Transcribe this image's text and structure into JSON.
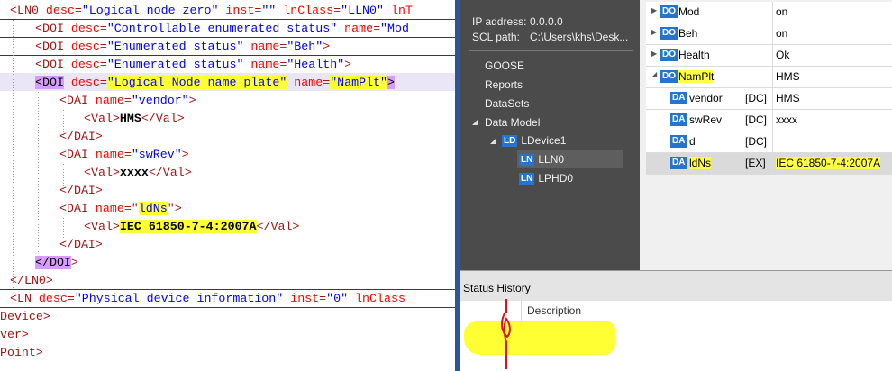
{
  "xml_editor": {
    "lines": [
      [
        {
          "c": "tg",
          "t": "<LN0 "
        },
        {
          "c": "at",
          "t": "desc"
        },
        {
          "c": "tg",
          "t": "="
        },
        {
          "c": "av",
          "t": "\"Logical node zero\""
        },
        {
          "c": "tg",
          "t": " "
        },
        {
          "c": "at",
          "t": "inst"
        },
        {
          "c": "tg",
          "t": "="
        },
        {
          "c": "av",
          "t": "\"\""
        },
        {
          "c": "tg",
          "t": " "
        },
        {
          "c": "at",
          "t": "lnClass"
        },
        {
          "c": "tg",
          "t": "="
        },
        {
          "c": "av",
          "t": "\"LLN0\""
        },
        {
          "c": "tg",
          "t": " "
        },
        {
          "c": "at",
          "t": "lnT"
        }
      ],
      [
        {
          "c": "tg",
          "t": "<DOI "
        },
        {
          "c": "at",
          "t": "desc"
        },
        {
          "c": "tg",
          "t": "="
        },
        {
          "c": "av",
          "t": "\"Controllable enumerated status\""
        },
        {
          "c": "tg",
          "t": " "
        },
        {
          "c": "at",
          "t": "name"
        },
        {
          "c": "tg",
          "t": "="
        },
        {
          "c": "av",
          "t": "\"Mod"
        }
      ],
      [
        {
          "c": "tg",
          "t": "<DOI "
        },
        {
          "c": "at",
          "t": "desc"
        },
        {
          "c": "tg",
          "t": "="
        },
        {
          "c": "av",
          "t": "\"Enumerated status\""
        },
        {
          "c": "tg",
          "t": " "
        },
        {
          "c": "at",
          "t": "name"
        },
        {
          "c": "tg",
          "t": "="
        },
        {
          "c": "av",
          "t": "\"Beh\""
        },
        {
          "c": "tg",
          "t": ">"
        }
      ],
      [
        {
          "c": "tg",
          "t": "<DOI "
        },
        {
          "c": "at",
          "t": "desc"
        },
        {
          "c": "tg",
          "t": "="
        },
        {
          "c": "av",
          "t": "\"Enumerated status\""
        },
        {
          "c": "tg",
          "t": " "
        },
        {
          "c": "at",
          "t": "name"
        },
        {
          "c": "tg",
          "t": "="
        },
        {
          "c": "av",
          "t": "\"Health\""
        },
        {
          "c": "tg",
          "t": ">"
        }
      ],
      [
        {
          "c": "tg hlt",
          "t": "<DOI"
        },
        {
          "c": "tg",
          "t": " "
        },
        {
          "c": "at",
          "t": "desc"
        },
        {
          "c": "tg",
          "t": "="
        },
        {
          "c": "av hl",
          "t": "\"Logical Node name plate\""
        },
        {
          "c": "tg",
          "t": " "
        },
        {
          "c": "at",
          "t": "name"
        },
        {
          "c": "tg",
          "t": "="
        },
        {
          "c": "av hl",
          "t": "\"NamPlt\""
        },
        {
          "c": "tg hlt",
          "t": ">"
        }
      ],
      [
        {
          "c": "tg",
          "t": "<DAI "
        },
        {
          "c": "at",
          "t": "name"
        },
        {
          "c": "tg",
          "t": "="
        },
        {
          "c": "av",
          "t": "\"vendor\""
        },
        {
          "c": "tg",
          "t": ">"
        }
      ],
      [
        {
          "c": "tg",
          "t": "<Val>"
        },
        {
          "c": "tx",
          "t": "HMS"
        },
        {
          "c": "tg",
          "t": "</Val>"
        }
      ],
      [
        {
          "c": "tg",
          "t": "</DAI>"
        }
      ],
      [
        {
          "c": "tg",
          "t": "<DAI "
        },
        {
          "c": "at",
          "t": "name"
        },
        {
          "c": "tg",
          "t": "="
        },
        {
          "c": "av",
          "t": "\"swRev\""
        },
        {
          "c": "tg",
          "t": ">"
        }
      ],
      [
        {
          "c": "tg",
          "t": "<Val>"
        },
        {
          "c": "tx",
          "t": "xxxx"
        },
        {
          "c": "tg",
          "t": "</Val>"
        }
      ],
      [
        {
          "c": "tg",
          "t": "</DAI>"
        }
      ],
      [
        {
          "c": "tg",
          "t": "<DAI "
        },
        {
          "c": "at",
          "t": "name"
        },
        {
          "c": "tg",
          "t": "=\""
        },
        {
          "c": "av hl",
          "t": "ldNs"
        },
        {
          "c": "tg",
          "t": "\">"
        }
      ],
      [
        {
          "c": "tg",
          "t": "<Val>"
        },
        {
          "c": "tx hl",
          "t": "IEC 61850-7-4:2007A"
        },
        {
          "c": "tg",
          "t": "</Val>"
        }
      ],
      [
        {
          "c": "tg",
          "t": "</DAI>"
        }
      ],
      [
        {
          "c": "tg hlt",
          "t": "</DOI"
        },
        {
          "c": "tg",
          "t": ">"
        }
      ],
      [
        {
          "c": "tg",
          "t": "</LN0>"
        }
      ],
      [
        {
          "c": "tg",
          "t": "<LN "
        },
        {
          "c": "at",
          "t": "desc"
        },
        {
          "c": "tg",
          "t": "="
        },
        {
          "c": "av",
          "t": "\"Physical device information\""
        },
        {
          "c": "tg",
          "t": " "
        },
        {
          "c": "at",
          "t": "inst"
        },
        {
          "c": "tg",
          "t": "="
        },
        {
          "c": "av",
          "t": "\"0\""
        },
        {
          "c": "tg",
          "t": " "
        },
        {
          "c": "at",
          "t": "lnClass"
        }
      ],
      [
        {
          "c": "tg",
          "t": "LDevice>"
        }
      ],
      [
        {
          "c": "tg",
          "t": "rver>"
        }
      ],
      [
        {
          "c": "tg",
          "t": "sPoint>"
        }
      ]
    ]
  },
  "nav": {
    "ip_label": "IP address:",
    "ip_value": "0.0.0.0",
    "scl_label": "SCL path:",
    "scl_value": "C:\\Users\\khs\\Desk...",
    "goose": "GOOSE",
    "reports": "Reports",
    "datasets": "DataSets",
    "data_model": "Data Model",
    "ld_badge": "LD",
    "ldevice": "LDevice1",
    "ln_badge": "LN",
    "lln0": "LLN0",
    "lphd0": "LPHD0"
  },
  "grid": {
    "rows": [
      {
        "badge": "DO",
        "name": "Mod",
        "tag": "",
        "value": "on"
      },
      {
        "badge": "DO",
        "name": "Beh",
        "tag": "",
        "value": "on"
      },
      {
        "badge": "DO",
        "name": "Health",
        "tag": "",
        "value": "Ok"
      },
      {
        "badge": "DO",
        "name": "NamPlt",
        "tag": "",
        "value": "HMS"
      },
      {
        "badge": "DA",
        "name": "vendor",
        "tag": "[DC]",
        "value": "HMS"
      },
      {
        "badge": "DA",
        "name": "swRev",
        "tag": "[DC]",
        "value": "xxxx"
      },
      {
        "badge": "DA",
        "name": "d",
        "tag": "[DC]",
        "value": ""
      },
      {
        "badge": "DA",
        "name": "ldNs",
        "tag": "[EX]",
        "value": "IEC 61850-7-4:2007A"
      }
    ]
  },
  "status": {
    "title": "Status History",
    "col_description": "Description"
  },
  "colors": {
    "accent_blue": "#2575d0",
    "highlight_yellow": "#ffff33",
    "nav_dark": "#4b4b4b",
    "divider_blue": "#2b579a"
  }
}
